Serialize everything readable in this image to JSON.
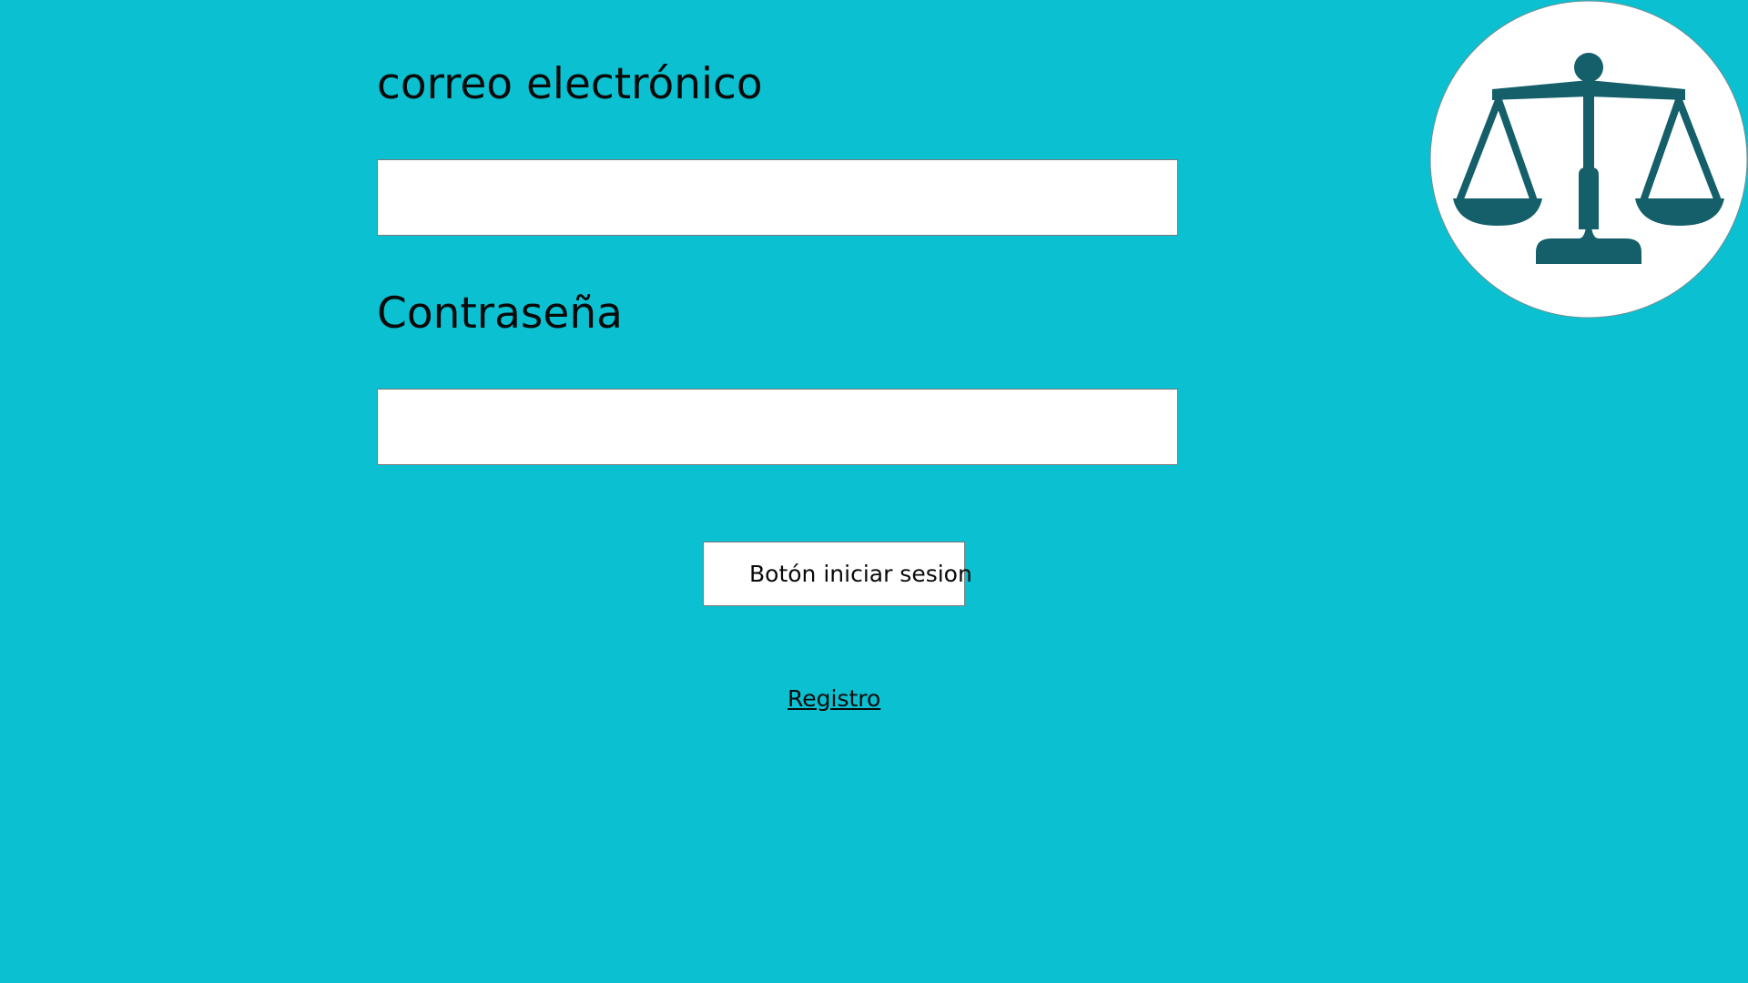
{
  "colors": {
    "background": "#0bc0d0",
    "field_background": "#ffffff",
    "text": "#0a0a0a",
    "logo_circle": "#ffffff",
    "logo_icon": "#145f69"
  },
  "form": {
    "email_label": "correo electrónico",
    "email_value": "",
    "password_label": "Contraseña",
    "password_value": "",
    "login_button_label": "Botón iniciar sesion",
    "register_link_label": "Registro"
  },
  "logo": {
    "icon": "scales-of-justice-icon"
  }
}
